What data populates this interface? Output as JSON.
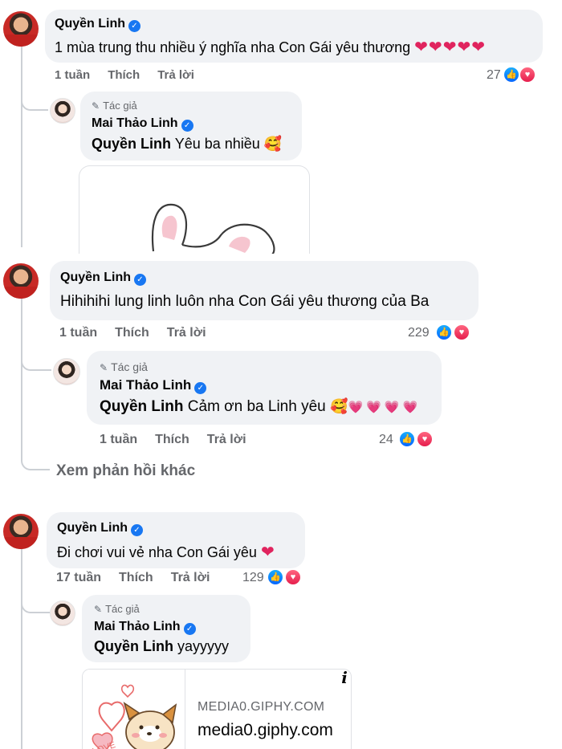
{
  "comments": [
    {
      "author": "Quyền Linh",
      "text": "1 mùa trung thu nhiều ý nghĩa nha Con Gái yêu thương",
      "hearts": "❤❤❤❤❤",
      "time": "1 tuần",
      "like_label": "Thích",
      "reply_label": "Trả lời",
      "reaction_count": "27",
      "reply": {
        "author_tag": "Tác giả",
        "author": "Mai Thảo Linh",
        "mention": "Quyền Linh",
        "text": "Yêu ba nhiều",
        "emoji": "🥰"
      }
    },
    {
      "author": "Quyền Linh",
      "text": "Hihihihi lung linh luôn nha Con Gái yêu thương của Ba",
      "time": "1 tuần",
      "like_label": "Thích",
      "reply_label": "Trả lời",
      "reaction_count": "229",
      "reply": {
        "author_tag": "Tác giả",
        "author": "Mai Thảo Linh",
        "mention": "Quyền Linh",
        "text": "Cảm ơn ba Linh yêu",
        "emoji": "🥰",
        "hearts": "💗💗💗💗",
        "time": "1 tuần",
        "like_label": "Thích",
        "reply_label": "Trả lời",
        "reaction_count": "24"
      },
      "more_replies": "Xem phản hồi khác"
    },
    {
      "author": "Quyền Linh",
      "text": "Đi chơi vui vẻ nha Con Gái yêu",
      "hearts": "❤",
      "time": "17 tuần",
      "like_label": "Thích",
      "reply_label": "Trả lời",
      "reaction_count": "129",
      "reply": {
        "author_tag": "Tác giả",
        "author": "Mai Thảo Linh",
        "mention": "Quyền Linh",
        "text": "yayyyyy",
        "link_caps": "MEDIA0.GIPHY.COM",
        "link_domain": "media0.giphy.com"
      }
    }
  ],
  "icons": {
    "verified": "verified-badge-icon",
    "author_pen": "pen-icon",
    "like": "like-reaction-icon",
    "love": "love-reaction-icon",
    "info": "info-icon"
  },
  "colors": {
    "bubble": "#f0f2f5",
    "verified": "#1877f2",
    "secondary_text": "#65676b"
  }
}
